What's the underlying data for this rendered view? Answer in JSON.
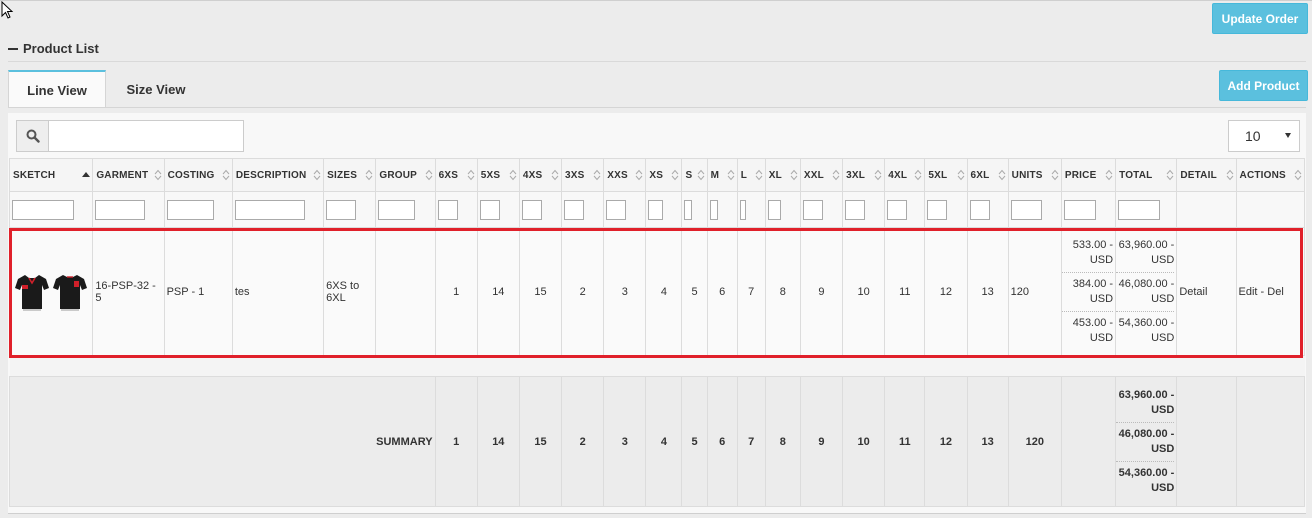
{
  "header": {
    "update_order_label": "Update Order",
    "section_title": "Product List",
    "add_product_label": "Add Product"
  },
  "tabs": [
    {
      "label": "Line View",
      "active": true
    },
    {
      "label": "Size View",
      "active": false
    }
  ],
  "search": {
    "placeholder": "",
    "value": ""
  },
  "page_size": {
    "value": "10"
  },
  "columns": [
    {
      "label": "SKETCH",
      "sort": "asc"
    },
    {
      "label": "GARMENT",
      "sort": "none"
    },
    {
      "label": "COSTING",
      "sort": "none"
    },
    {
      "label": "DESCRIPTION",
      "sort": "none"
    },
    {
      "label": "SIZES",
      "sort": "none"
    },
    {
      "label": "GROUP",
      "sort": "none"
    },
    {
      "label": "6XS",
      "sort": "none"
    },
    {
      "label": "5XS",
      "sort": "none"
    },
    {
      "label": "4XS",
      "sort": "none"
    },
    {
      "label": "3XS",
      "sort": "none"
    },
    {
      "label": "XXS",
      "sort": "none"
    },
    {
      "label": "XS",
      "sort": "none"
    },
    {
      "label": "S",
      "sort": "none"
    },
    {
      "label": "M",
      "sort": "none"
    },
    {
      "label": "L",
      "sort": "none"
    },
    {
      "label": "XL",
      "sort": "none"
    },
    {
      "label": "XXL",
      "sort": "none"
    },
    {
      "label": "3XL",
      "sort": "none"
    },
    {
      "label": "4XL",
      "sort": "none"
    },
    {
      "label": "5XL",
      "sort": "none"
    },
    {
      "label": "6XL",
      "sort": "none"
    },
    {
      "label": "UNITS",
      "sort": "none"
    },
    {
      "label": "PRICE",
      "sort": "none"
    },
    {
      "label": "TOTAL",
      "sort": "none"
    },
    {
      "label": "DETAIL",
      "sort": "none"
    },
    {
      "label": "ACTIONS",
      "sort": "none"
    }
  ],
  "row": {
    "garment": "16-PSP-32 - 5",
    "costing": "PSP - 1",
    "description": "tes",
    "sizes": "6XS to 6XL",
    "group": "",
    "qty": [
      "1",
      "14",
      "15",
      "2",
      "3",
      "4",
      "5",
      "6",
      "7",
      "8",
      "9",
      "10",
      "11",
      "12",
      "13"
    ],
    "units": "120",
    "prices": [
      "533.00 - USD",
      "384.00 - USD",
      "453.00 - USD"
    ],
    "totals": [
      "63,960.00 - USD",
      "46,080.00 - USD",
      "54,360.00 - USD"
    ],
    "detail": "Detail",
    "actions": "Edit - Del"
  },
  "summary": {
    "label": "SUMMARY",
    "qty": [
      "1",
      "14",
      "15",
      "2",
      "3",
      "4",
      "5",
      "6",
      "7",
      "8",
      "9",
      "10",
      "11",
      "12",
      "13"
    ],
    "units": "120",
    "totals": [
      "63,960.00 - USD",
      "46,080.00 - USD",
      "54,360.00 - USD"
    ]
  },
  "colors": {
    "accent": "#5bc0de",
    "highlight": "#e0202a",
    "shirt": "#1a1a1a",
    "shirt_trim": "#d0202a"
  },
  "icons": [
    "search-icon",
    "minus-icon",
    "sort-icon",
    "sort-asc-icon",
    "caret-down-icon",
    "cursor-icon",
    "shirt-front-icon",
    "shirt-back-icon"
  ]
}
